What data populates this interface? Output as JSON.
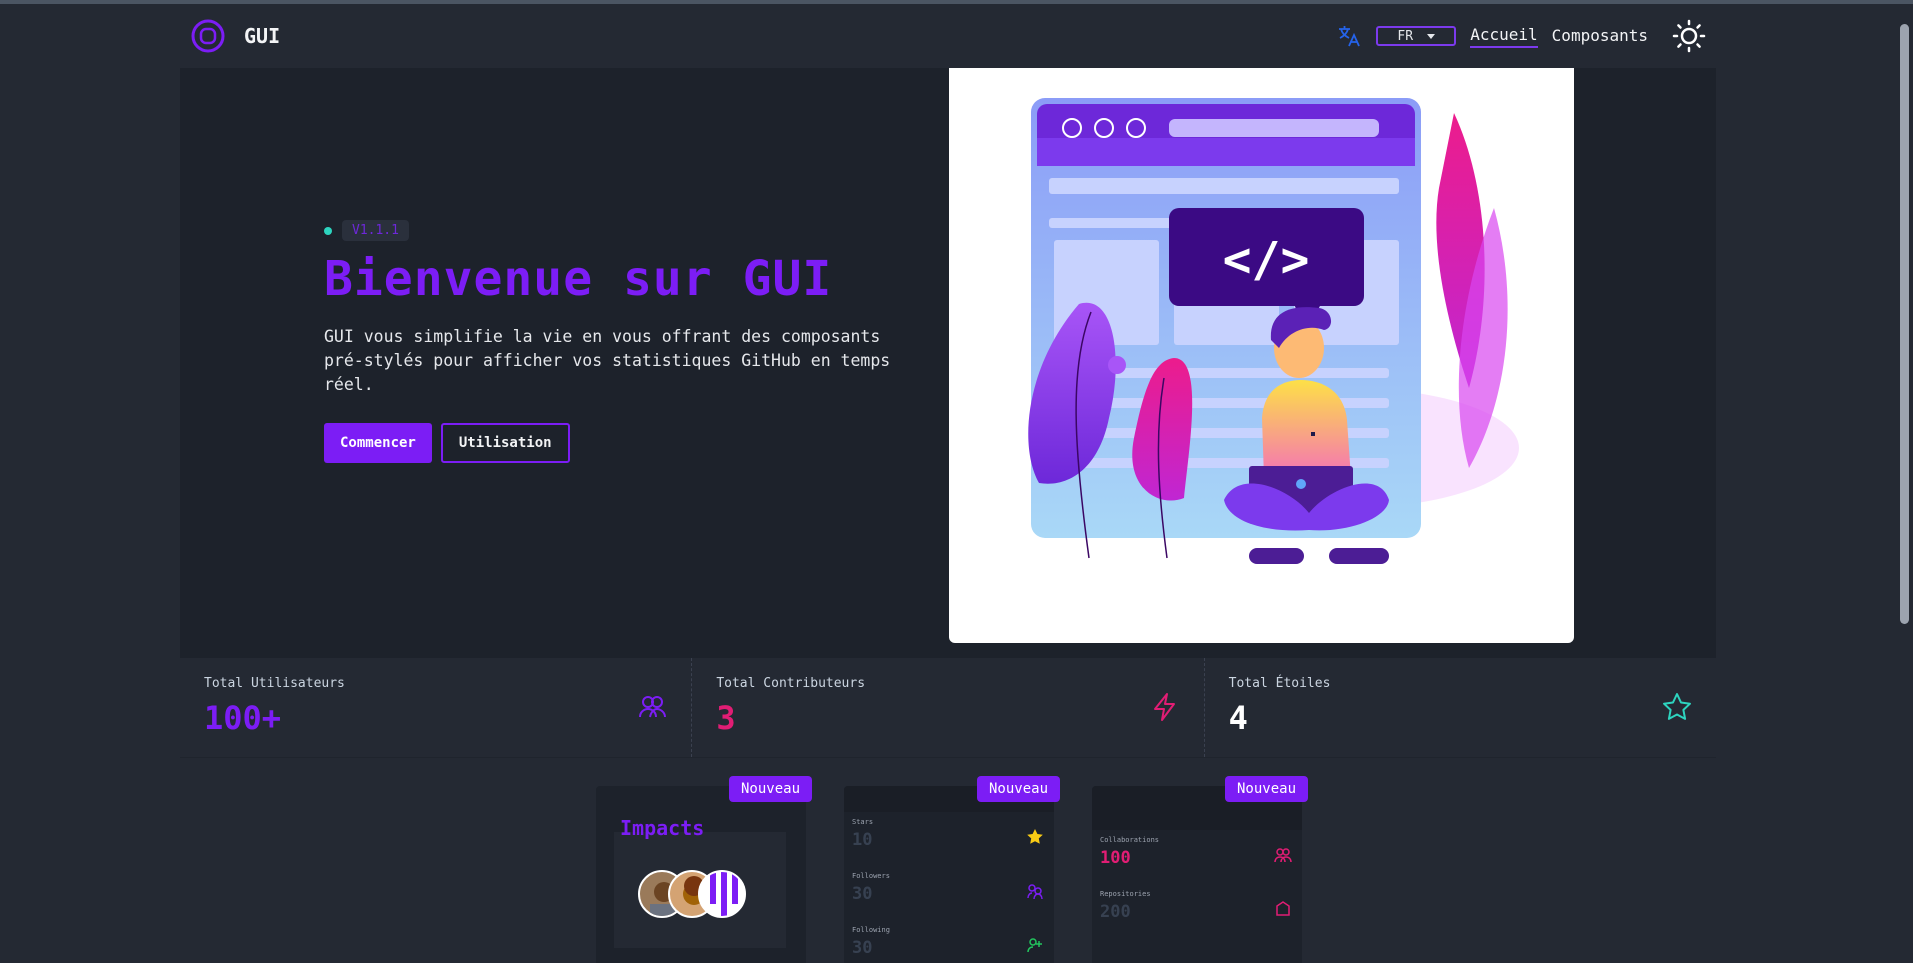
{
  "app": {
    "brand": "GUI"
  },
  "nav": {
    "language": "FR",
    "links": [
      "Accueil",
      "Composants"
    ]
  },
  "hero": {
    "version": "V1.1.1",
    "title": "Bienvenue sur GUI",
    "description": "GUI vous simplifie la vie en vous offrant des composants pré-stylés pour afficher vos statistiques GitHub en temps réel.",
    "primary_button": "Commencer",
    "secondary_button": "Utilisation"
  },
  "stats": [
    {
      "label": "Total Utilisateurs",
      "value": "100+",
      "color": "#7c1df5",
      "icon": "users-icon"
    },
    {
      "label": "Total Contributeurs",
      "value": "3",
      "color": "#e11d74",
      "icon": "lightning-icon"
    },
    {
      "label": "Total Étoiles",
      "value": "4",
      "color": "#ffffff",
      "icon": "star-icon"
    }
  ],
  "cards": {
    "new_label": "Nouveau",
    "impact": {
      "title": "Impacts"
    },
    "profile": {
      "rows": [
        {
          "label": "Stars",
          "value": "10"
        },
        {
          "label": "Followers",
          "value": "30"
        },
        {
          "label": "Following",
          "value": "30"
        }
      ]
    },
    "collab": {
      "rows": [
        {
          "label": "Collaborations",
          "value": "100"
        },
        {
          "label": "Repositories",
          "value": "200"
        }
      ]
    }
  },
  "colors": {
    "accent": "#7c1df5",
    "pink": "#e11d74",
    "teal": "#2dd4bf",
    "background": "#242933"
  }
}
